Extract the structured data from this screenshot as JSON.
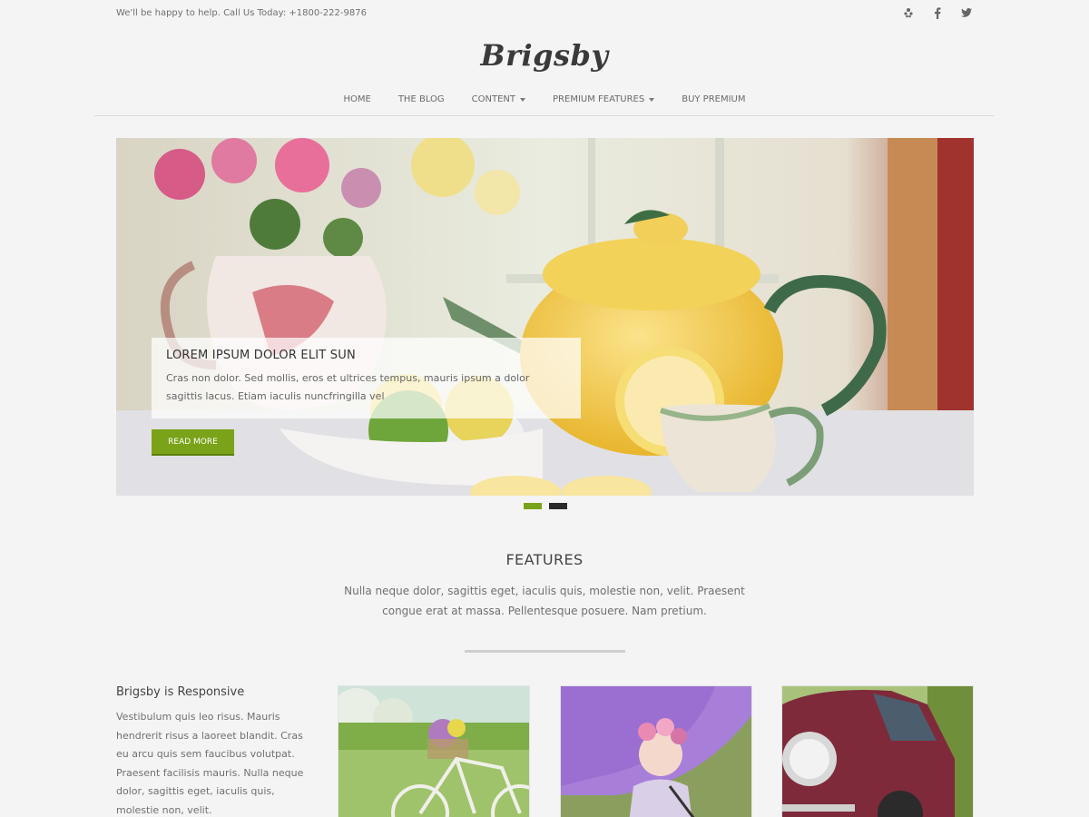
{
  "topbar": {
    "help_text": "We'll be happy to help. Call Us Today: +1800-222-9876",
    "social": [
      "yelp-icon",
      "facebook-icon",
      "twitter-icon"
    ]
  },
  "logo": "Brigsby",
  "nav": {
    "items": [
      {
        "label": "HOME"
      },
      {
        "label": "THE BLOG"
      },
      {
        "label": "CONTENT"
      },
      {
        "label": "PREMIUM FEATURES"
      },
      {
        "label": "BUY PREMIUM"
      }
    ]
  },
  "slider": {
    "caption_title": "LOREM IPSUM DOLOR ELIT SUN",
    "caption_text": "Cras non dolor. Sed mollis, eros et ultrices tempus, mauris ipsum a dolor sagittis lacus. Etiam iaculis nuncfringilla vel",
    "button_label": "READ MORE",
    "active_slide": 1,
    "slide_count": 2
  },
  "features": {
    "title": "FEATURES",
    "text": "Nulla neque dolor, sagittis eget, iaculis quis, molestie non, velit. Praesent congue erat at massa. Pellentesque posuere. Nam pretium."
  },
  "column": {
    "title": "Brigsby is Responsive",
    "body": "Vestibulum quis leo risus. Mauris hendrerit risus a laoreet blandit. Cras eu arcu quis sem faucibus volutpat. Praesent facilisis mauris. Nulla neque dolor, sagittis eget, iaculis quis, molestie non, velit."
  },
  "colors": {
    "accent": "#7aa319",
    "background": "#f4f4f4",
    "dot_inactive": "#2a2a2a"
  }
}
